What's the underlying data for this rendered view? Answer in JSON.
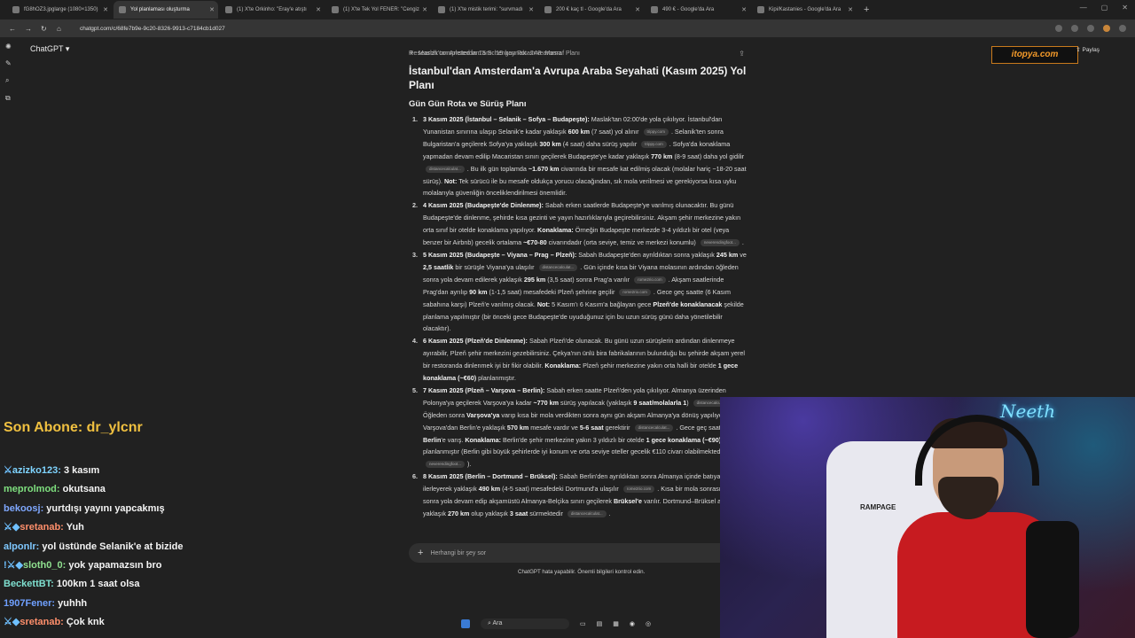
{
  "browser": {
    "tabs": [
      {
        "label": "fG8hOZ3.jpglarge (1080×1350)",
        "active": false
      },
      {
        "label": "Yol planlaması oluşturma",
        "active": true
      },
      {
        "label": "(1) X'te Orkinho: \"Eray'e atıştı",
        "active": false
      },
      {
        "label": "(1) X'te Tek Yol FENER: \"Cengiz",
        "active": false
      },
      {
        "label": "(1) X'te mistik terimi: \"survmadı",
        "active": false
      },
      {
        "label": "200 € kaç tl - Google'da Ara",
        "active": false
      },
      {
        "label": "490 € - Google'da Ara",
        "active": false
      },
      {
        "label": "Kipi/Kastanies - Google'da Ara",
        "active": false
      }
    ],
    "url": "chatgpt.com/c/68fe7b9e-9c20-8326-9913-c7184cb1d027"
  },
  "app": {
    "brand": "ChatGPT",
    "share_label": "Paylaş",
    "research_status": "Research completed in 15m· 15 kaynak· 248 arama",
    "logo_text": "itopya.com"
  },
  "doc": {
    "breadcrumb": "Maslak'tan Amsterdam'a Schengen Rotası ve Masraf Planı",
    "title": "İstanbul'dan Amsterdam'a Avrupa Araba Seyahati (Kasım 2025) Yol Planı",
    "section": "Gün Gün Rota ve Sürüş Planı"
  },
  "composer": {
    "placeholder": "Herhangi bir şey sor",
    "disclaimer": "ChatGPT hata yapabilir. Önemli bilgileri kontrol edin."
  },
  "stream": {
    "sub_label": "Son Abone: dr_ylcnr",
    "messages": [
      {
        "user": "azizko123:",
        "text": " 3 kasım",
        "color": "#7fd4ff",
        "prefix": "⚔"
      },
      {
        "user": "meprolmod:",
        "text": " okutsana",
        "color": "#7fe07f",
        "prefix": ""
      },
      {
        "user": "bekoosj:",
        "text": " yurtdışı yayını yapcakmış",
        "color": "#7fa8ff",
        "prefix": ""
      },
      {
        "user": "sretanab:",
        "text": " Yuh",
        "color": "#ff8f6b",
        "prefix": "⚔◆"
      },
      {
        "user": "alponlr:",
        "text": " yol üstünde Selanik'e at bizide",
        "color": "#7fc8ff",
        "prefix": ""
      },
      {
        "user": "sloth0_0:",
        "text": " yok yapamazsın bro",
        "color": "#8fe08f",
        "prefix": "!⚔◆"
      },
      {
        "user": "BeckettBT:",
        "text": " 100km 1 saat olsa",
        "color": "#7fe0d0",
        "prefix": ""
      },
      {
        "user": "1907Fener:",
        "text": " yuhhh",
        "color": "#6fa0ff",
        "prefix": ""
      },
      {
        "user": "sretanab:",
        "text": " Çok knk",
        "color": "#ff8f6b",
        "prefix": "⚔◆"
      }
    ]
  },
  "camera": {
    "neon_text": "Neeth",
    "chair_brand": "RAMPAGE"
  },
  "taskbar": {
    "search_label": "Ara"
  }
}
